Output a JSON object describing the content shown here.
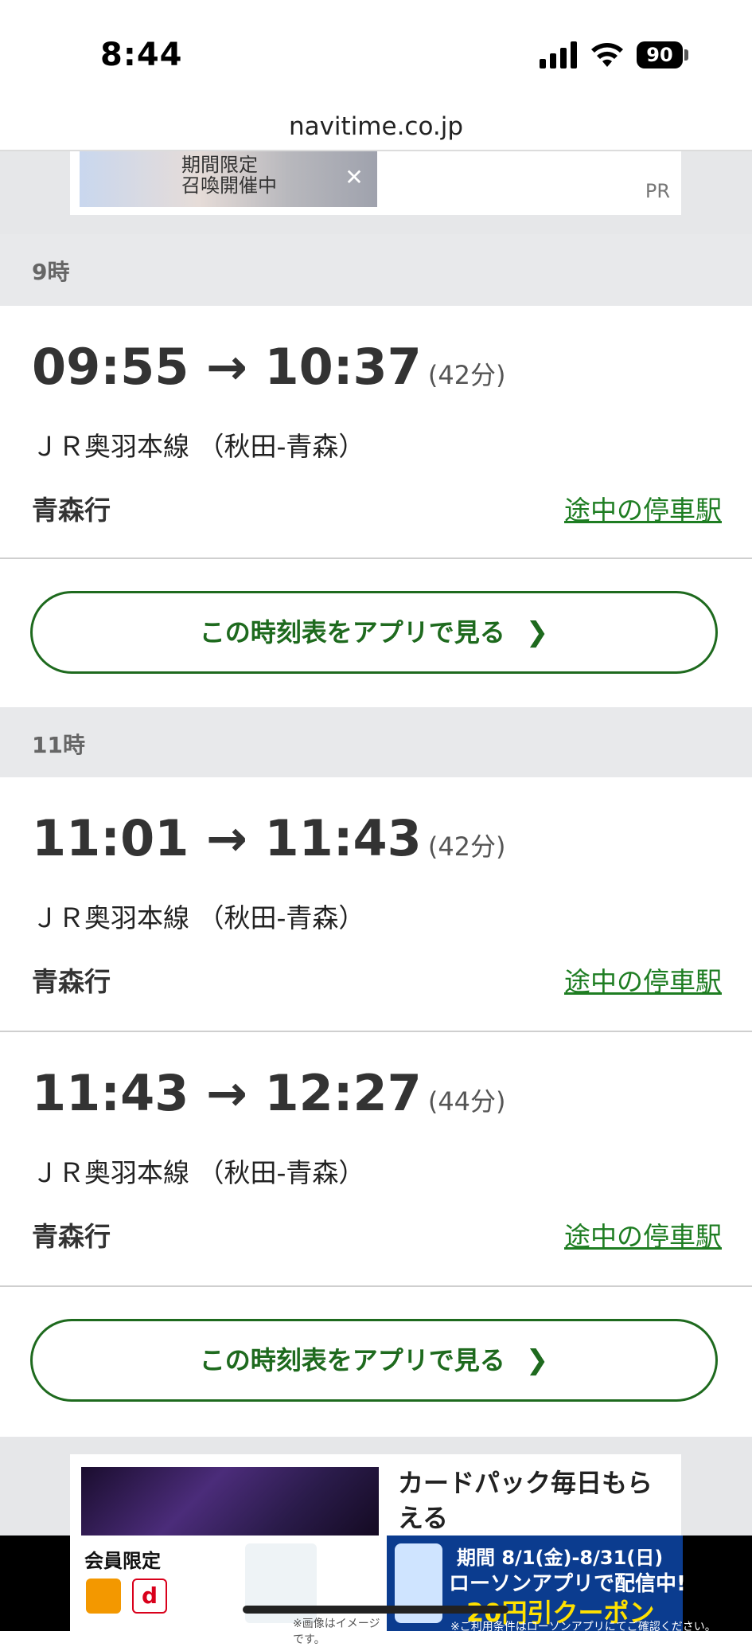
{
  "status_bar": {
    "time": "8:44",
    "battery": "90"
  },
  "url": "navitime.co.jp",
  "ad_top": {
    "text": "期間限定\n召喚開催中",
    "close": "✕",
    "label": "PR"
  },
  "sections": [
    {
      "hour_label": "9時",
      "entries": [
        {
          "times": "09:55 → 10:37",
          "duration": "(42分)",
          "line": "ＪＲ奥羽本線 （秋田-青森）",
          "destination": "青森行",
          "stops_link": "途中の停車駅"
        }
      ],
      "app_button": "この時刻表をアプリで見る"
    },
    {
      "hour_label": "11時",
      "entries": [
        {
          "times": "11:01 → 11:43",
          "duration": "(42分)",
          "line": "ＪＲ奥羽本線 （秋田-青森）",
          "destination": "青森行",
          "stops_link": "途中の停車駅"
        },
        {
          "times": "11:43 → 12:27",
          "duration": "(44分)",
          "line": "ＪＲ奥羽本線 （秋田-青森）",
          "destination": "青森行",
          "stops_link": "途中の停車駅"
        }
      ],
      "app_button": "この時刻表をアプリで見る"
    }
  ],
  "ad_bottom": {
    "text": "カードパック毎日もらえる"
  },
  "banner": {
    "member": "会員限定",
    "dpoint": "d",
    "note": "※画像はイメージです。",
    "period": "期間 8/1(金)-8/31(日)",
    "lawson": "ローソンアプリで配信中!",
    "coupon": "20円引クーポン",
    "fine": "※ご利用条件はローソンアプリにてご確認ください。"
  },
  "colors": {
    "accent_green": "#1e6a1e",
    "link_green": "#1e7d22",
    "hour_bg": "#e8e9eb"
  },
  "icons": [
    "signal-icon",
    "wifi-icon",
    "battery-icon",
    "chevron-right-icon",
    "close-icon"
  ]
}
